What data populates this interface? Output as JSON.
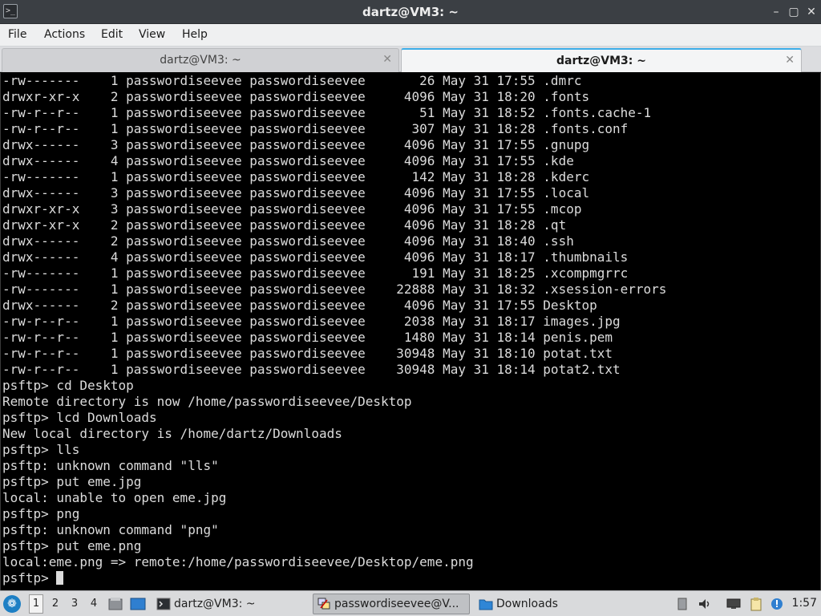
{
  "window": {
    "title": "dartz@VM3: ~",
    "icon": "terminal-icon",
    "controls": {
      "minimize": "–",
      "maximize": "▢",
      "close": "✕"
    }
  },
  "menu": [
    "File",
    "Actions",
    "Edit",
    "View",
    "Help"
  ],
  "tabs": [
    {
      "label": "dartz@VM3: ~",
      "close": "✕"
    },
    {
      "label": "dartz@VM3: ~",
      "close": "✕"
    }
  ],
  "terminal": {
    "lines": [
      "-rw-------    1 passwordiseevee passwordiseevee       26 May 31 17:55 .dmrc",
      "drwxr-xr-x    2 passwordiseevee passwordiseevee     4096 May 31 18:20 .fonts",
      "-rw-r--r--    1 passwordiseevee passwordiseevee       51 May 31 18:52 .fonts.cache-1",
      "-rw-r--r--    1 passwordiseevee passwordiseevee      307 May 31 18:28 .fonts.conf",
      "drwx------    3 passwordiseevee passwordiseevee     4096 May 31 17:55 .gnupg",
      "drwx------    4 passwordiseevee passwordiseevee     4096 May 31 17:55 .kde",
      "-rw-------    1 passwordiseevee passwordiseevee      142 May 31 18:28 .kderc",
      "drwx------    3 passwordiseevee passwordiseevee     4096 May 31 17:55 .local",
      "drwxr-xr-x    3 passwordiseevee passwordiseevee     4096 May 31 17:55 .mcop",
      "drwxr-xr-x    2 passwordiseevee passwordiseevee     4096 May 31 18:28 .qt",
      "drwx------    2 passwordiseevee passwordiseevee     4096 May 31 18:40 .ssh",
      "drwx------    4 passwordiseevee passwordiseevee     4096 May 31 18:17 .thumbnails",
      "-rw-------    1 passwordiseevee passwordiseevee      191 May 31 18:25 .xcompmgrrc",
      "-rw-------    1 passwordiseevee passwordiseevee    22888 May 31 18:32 .xsession-errors",
      "drwx------    2 passwordiseevee passwordiseevee     4096 May 31 17:55 Desktop",
      "-rw-r--r--    1 passwordiseevee passwordiseevee     2038 May 31 18:17 images.jpg",
      "-rw-r--r--    1 passwordiseevee passwordiseevee     1480 May 31 18:14 penis.pem",
      "-rw-r--r--    1 passwordiseevee passwordiseevee    30948 May 31 18:10 potat.txt",
      "-rw-r--r--    1 passwordiseevee passwordiseevee    30948 May 31 18:14 potat2.txt",
      "psftp> cd Desktop",
      "Remote directory is now /home/passwordiseevee/Desktop",
      "psftp> lcd Downloads",
      "New local directory is /home/dartz/Downloads",
      "psftp> lls",
      "psftp: unknown command \"lls\"",
      "psftp> put eme.jpg",
      "local: unable to open eme.jpg",
      "psftp> png",
      "psftp: unknown command \"png\"",
      "psftp> put eme.png",
      "local:eme.png => remote:/home/passwordiseevee/Desktop/eme.png",
      "psftp> "
    ]
  },
  "taskbar": {
    "start_icon": "start-menu-icon",
    "workspaces": [
      "1",
      "2",
      "3",
      "4"
    ],
    "active_workspace": "1",
    "tasks": [
      {
        "label": "dartz@VM3: ~",
        "icon": "terminal-icon",
        "active": false
      },
      {
        "label": "passwordiseevee@V...",
        "icon": "putty-icon",
        "active": true
      },
      {
        "label": "Downloads",
        "icon": "folder-icon",
        "active": false
      }
    ],
    "clock": "1:57"
  },
  "colors": {
    "terminal_bg": "#000000",
    "terminal_fg": "#dcdcdc",
    "titlebar": "#3b3f44",
    "accent": "#3daee9"
  }
}
